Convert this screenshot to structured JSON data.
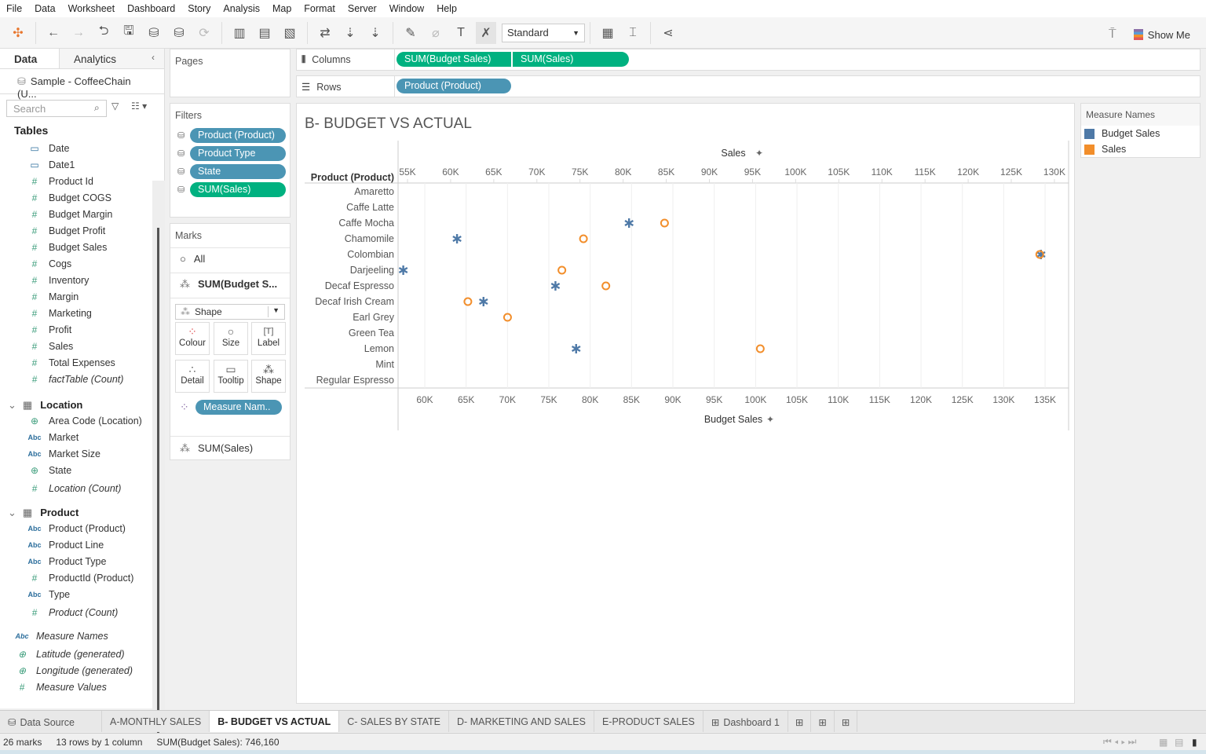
{
  "menu": [
    "File",
    "Data",
    "Worksheet",
    "Dashboard",
    "Story",
    "Analysis",
    "Map",
    "Format",
    "Server",
    "Window",
    "Help"
  ],
  "toolbar": {
    "fit_select": "Standard",
    "show_me": "Show Me"
  },
  "left_pane": {
    "tabs": [
      "Data",
      "Analytics"
    ],
    "data_source": "Sample - CoffeeChain (U...",
    "search_placeholder": "Search",
    "tables_label": "Tables",
    "fields_top": [
      {
        "icon": "calendar-icon",
        "label": "Date"
      },
      {
        "icon": "calendar-icon",
        "label": "Date1"
      },
      {
        "icon": "number-icon",
        "label": "Product Id"
      },
      {
        "icon": "number-icon",
        "label": "Budget COGS"
      },
      {
        "icon": "number-icon",
        "label": "Budget Margin"
      },
      {
        "icon": "number-icon",
        "label": "Budget Profit"
      },
      {
        "icon": "number-icon",
        "label": "Budget Sales"
      },
      {
        "icon": "number-icon",
        "label": "Cogs"
      },
      {
        "icon": "number-icon",
        "label": "Inventory"
      },
      {
        "icon": "number-icon",
        "label": "Margin"
      },
      {
        "icon": "number-icon",
        "label": "Marketing"
      },
      {
        "icon": "number-icon",
        "label": "Profit"
      },
      {
        "icon": "number-icon",
        "label": "Sales"
      },
      {
        "icon": "number-icon",
        "label": "Total Expenses"
      },
      {
        "icon": "number-icon",
        "label": "factTable (Count)"
      }
    ],
    "location_group": "Location",
    "location_fields": [
      {
        "icon": "globe-icon",
        "label": "Area Code (Location)"
      },
      {
        "icon": "abc-icon",
        "label": "Market"
      },
      {
        "icon": "abc-icon",
        "label": "Market Size"
      },
      {
        "icon": "globe-icon",
        "label": "State"
      },
      {
        "icon": "number-icon",
        "label": "Location (Count)"
      }
    ],
    "product_group": "Product",
    "product_fields": [
      {
        "icon": "abc-icon",
        "label": "Product (Product)"
      },
      {
        "icon": "abc-icon",
        "label": "Product Line"
      },
      {
        "icon": "abc-icon",
        "label": "Product Type"
      },
      {
        "icon": "number-icon",
        "label": "ProductId (Product)"
      },
      {
        "icon": "abc-icon",
        "label": "Type"
      },
      {
        "icon": "number-icon",
        "label": "Product (Count)"
      }
    ],
    "extra_fields": [
      {
        "icon": "abc-icon",
        "label": "Measure Names"
      },
      {
        "icon": "globe-icon",
        "label": "Latitude (generated)"
      },
      {
        "icon": "globe-icon",
        "label": "Longitude (generated)"
      },
      {
        "icon": "number-icon",
        "label": "Measure Values"
      }
    ]
  },
  "pages": {
    "title": "Pages"
  },
  "filters": {
    "title": "Filters",
    "items": [
      "Product (Product)",
      "Product Type",
      "State",
      "SUM(Sales)"
    ]
  },
  "marks": {
    "title": "Marks",
    "all": "All",
    "card1": "SUM(Budget S...",
    "mark_type": "Shape",
    "buttons": [
      "Colour",
      "Size",
      "Label",
      "Detail",
      "Tooltip",
      "Shape"
    ],
    "colour_pill": "Measure Nam..",
    "card2": "SUM(Sales)"
  },
  "shelves": {
    "columns_label": "Columns",
    "columns": [
      "SUM(Budget Sales)",
      "SUM(Sales)"
    ],
    "rows_label": "Rows",
    "rows": [
      "Product (Product)"
    ]
  },
  "legend": {
    "title": "Measure Names",
    "items": [
      {
        "label": "Budget Sales",
        "color": "#4e79a7"
      },
      {
        "label": "Sales",
        "color": "#f28e2b"
      }
    ]
  },
  "chart_data": {
    "type": "scatter",
    "title": "B- BUDGET VS ACTUAL",
    "row_header": "Product (Product)",
    "categories": [
      "Amaretto",
      "Caffe Latte",
      "Caffe Mocha",
      "Chamomile",
      "Colombian",
      "Darjeeling",
      "Decaf Espresso",
      "Decaf Irish Cream",
      "Earl Grey",
      "Green Tea",
      "Lemon",
      "Mint",
      "Regular Espresso"
    ],
    "top_axis": {
      "label": "Sales",
      "range": [
        52500,
        132000
      ],
      "ticks": [
        "55K",
        "60K",
        "65K",
        "70K",
        "75K",
        "80K",
        "85K",
        "90K",
        "95K",
        "100K",
        "105K",
        "110K",
        "115K",
        "120K",
        "125K",
        "130K"
      ],
      "tick_values": [
        55000,
        60000,
        65000,
        70000,
        75000,
        80000,
        85000,
        90000,
        95000,
        100000,
        105000,
        110000,
        115000,
        120000,
        125000,
        130000
      ]
    },
    "bottom_axis": {
      "label": "Budget Sales",
      "range": [
        56900,
        138500
      ],
      "ticks": [
        "60K",
        "65K",
        "70K",
        "75K",
        "80K",
        "85K",
        "90K",
        "95K",
        "100K",
        "105K",
        "110K",
        "115K",
        "120K",
        "125K",
        "130K",
        "135K"
      ],
      "tick_values": [
        60000,
        65000,
        70000,
        75000,
        80000,
        85000,
        90000,
        95000,
        100000,
        105000,
        110000,
        115000,
        120000,
        125000,
        130000,
        135000
      ]
    },
    "series": [
      {
        "name": "Budget Sales",
        "color": "#4e79a7",
        "shape": "asterisk",
        "axis": "bottom",
        "values": [
          null,
          null,
          84700,
          63900,
          134500,
          57400,
          75800,
          67100,
          null,
          null,
          78300,
          null,
          null
        ]
      },
      {
        "name": "Sales",
        "color": "#f28e2b",
        "shape": "circle",
        "axis": "top",
        "values": [
          null,
          null,
          84800,
          75400,
          128300,
          72900,
          78000,
          62000,
          66600,
          null,
          95900,
          null,
          null
        ]
      }
    ],
    "grid": true,
    "legend": "right"
  },
  "sheet_tabs": [
    "Data Source",
    "A-MONTHLY SALES",
    "B- BUDGET VS ACTUAL",
    "C- SALES BY STATE",
    "D- MARKETING AND SALES",
    "E-PRODUCT SALES",
    "Dashboard 1"
  ],
  "status": {
    "marks": "26 marks",
    "dims": "13 rows by 1 column",
    "sum": "SUM(Budget Sales): 746,160"
  }
}
